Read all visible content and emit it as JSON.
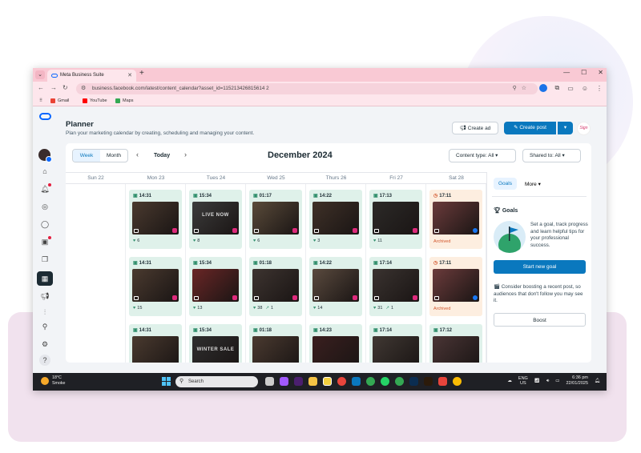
{
  "browser": {
    "tab_title": "Meta Business Suite",
    "url": "business.facebook.com/latest/content_calendar?asset_id=115213426815614 2",
    "bookmarks": [
      {
        "label": "Gmail",
        "icon": "gmail-icon",
        "color": "#ea4335"
      },
      {
        "label": "YouTube",
        "icon": "youtube-icon",
        "color": "#ff0000"
      },
      {
        "label": "Maps",
        "icon": "maps-icon",
        "color": "#34a853"
      }
    ]
  },
  "header": {
    "title": "Planner",
    "subtitle": "Plan your marketing calendar by creating, scheduling and managing your content.",
    "create_ad": "Create ad",
    "create_post": "Create post"
  },
  "brand_avatar_text": "Sign",
  "calendar": {
    "view_week": "Week",
    "view_month": "Month",
    "today": "Today",
    "month_title": "December 2024",
    "content_type": "Content type: All",
    "shared_to": "Shared to: All",
    "days": [
      "Sun 22",
      "Mon 23",
      "Tues 24",
      "Wed 25",
      "Thurs 26",
      "Fri 27",
      "Sat 28"
    ],
    "rows": [
      [
        {
          "time": "14:31",
          "likes": "6",
          "shares": "",
          "thumb": "#4a3a2f",
          "text": "",
          "badge": "instagram"
        },
        {
          "time": "15:34",
          "likes": "8",
          "shares": "",
          "thumb": "#3c3c3c",
          "text": "LIVE NOW",
          "badge": "instagram"
        },
        {
          "time": "01:17",
          "likes": "6",
          "shares": "",
          "thumb": "#5a4b3a",
          "text": "",
          "badge": "instagram"
        },
        {
          "time": "14:22",
          "likes": "3",
          "shares": "",
          "thumb": "#3f3128",
          "text": "",
          "badge": "instagram"
        },
        {
          "time": "17:13",
          "likes": "11",
          "shares": "",
          "thumb": "#2c2a28",
          "text": "",
          "badge": "instagram"
        },
        {
          "time": "17:11",
          "likes": "",
          "shares": "",
          "thumb": "#6b3b3b",
          "text": "",
          "badge": "facebook",
          "archived": "Archived"
        }
      ],
      [
        {
          "time": "14:31",
          "likes": "15",
          "shares": "",
          "thumb": "#4a3a2f",
          "text": "",
          "badge": "instagram"
        },
        {
          "time": "15:34",
          "likes": "13",
          "shares": "",
          "thumb": "#6a2626",
          "text": "",
          "badge": "instagram"
        },
        {
          "time": "01:18",
          "likes": "38",
          "shares": "1",
          "thumb": "#3d3430",
          "text": "",
          "badge": "instagram"
        },
        {
          "time": "14:22",
          "likes": "14",
          "shares": "",
          "thumb": "#5a4a3e",
          "text": "",
          "badge": "instagram"
        },
        {
          "time": "17:14",
          "likes": "31",
          "shares": "1",
          "thumb": "#3a3330",
          "text": "",
          "badge": "instagram"
        },
        {
          "time": "17:11",
          "likes": "",
          "shares": "",
          "thumb": "#6b3b3b",
          "text": "",
          "badge": "facebook",
          "archived": "Archived"
        }
      ],
      [
        {
          "time": "14:31",
          "likes": "",
          "shares": "",
          "thumb": "#4a3a2f",
          "text": "",
          "badge": ""
        },
        {
          "time": "15:34",
          "likes": "",
          "shares": "",
          "thumb": "#2e2e2e",
          "text": "WINTER SALE",
          "badge": ""
        },
        {
          "time": "01:18",
          "likes": "",
          "shares": "",
          "thumb": "#4a3a30",
          "text": "",
          "badge": ""
        },
        {
          "time": "14:23",
          "likes": "",
          "shares": "",
          "thumb": "#3a1f1f",
          "text": "",
          "badge": ""
        },
        {
          "time": "17:14",
          "likes": "",
          "shares": "",
          "thumb": "#403833",
          "text": "",
          "badge": ""
        },
        {
          "time": "17:12",
          "likes": "",
          "shares": "",
          "thumb": "#4a3535",
          "text": "",
          "badge": "facebook"
        }
      ]
    ]
  },
  "right_panel": {
    "tab_goals": "Goals",
    "tab_more": "More",
    "goals_title": "Goals",
    "goals_text": "Set a goal, track progress and learn helpful tips for your professional success.",
    "start_goal": "Start new goal",
    "boost_text": "Consider boosting a recent post, so audiences that don't follow you may see it.",
    "boost": "Boost"
  },
  "taskbar": {
    "temp": "18°C",
    "weather": "Smoke",
    "search_placeholder": "Search",
    "lang1": "ENG",
    "lang2": "US",
    "time": "6:36 pm",
    "date": "22/01/2025"
  },
  "colors": {
    "accent": "#0a78be",
    "post_bg": "#dff1ea",
    "archived_bg": "#fdeee0",
    "chrome_pink": "#f9c9d4"
  }
}
